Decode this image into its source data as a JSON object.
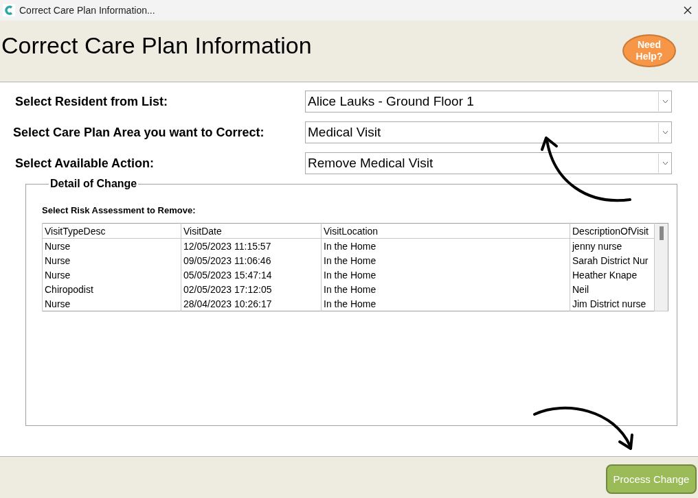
{
  "window": {
    "title": "Correct Care Plan Information..."
  },
  "header": {
    "title": "Correct Care Plan Information",
    "help_button": "Need Help?"
  },
  "fields": [
    {
      "label": "Select Resident from List:",
      "value": "Alice Lauks - Ground Floor 1"
    },
    {
      "label": "Select Care Plan Area you want to Correct:",
      "value": "Medical Visit"
    },
    {
      "label": "Select Available Action:",
      "value": "Remove Medical Visit"
    }
  ],
  "detail_group": {
    "title": "Detail of Change",
    "list_label": "Select Risk Assessment to Remove:",
    "table": {
      "columns": [
        "VisitTypeDesc",
        "VisitDate",
        "VisitLocation",
        "DescriptionOfVisit"
      ],
      "rows": [
        [
          "Nurse",
          "12/05/2023 11:15:57",
          "In the Home",
          "jenny nurse"
        ],
        [
          "Nurse",
          "09/05/2023 11:06:46",
          "In the Home",
          "Sarah District Nur"
        ],
        [
          "Nurse",
          "05/05/2023 15:47:14",
          "In the Home",
          "Heather Knape"
        ],
        [
          "Chiropodist",
          "02/05/2023 17:12:05",
          "In the Home",
          "Neil"
        ],
        [
          "Nurse",
          "28/04/2023 10:26:17",
          "In the Home",
          "Jim District nurse"
        ]
      ]
    }
  },
  "footer": {
    "process_button": "Process Change"
  }
}
